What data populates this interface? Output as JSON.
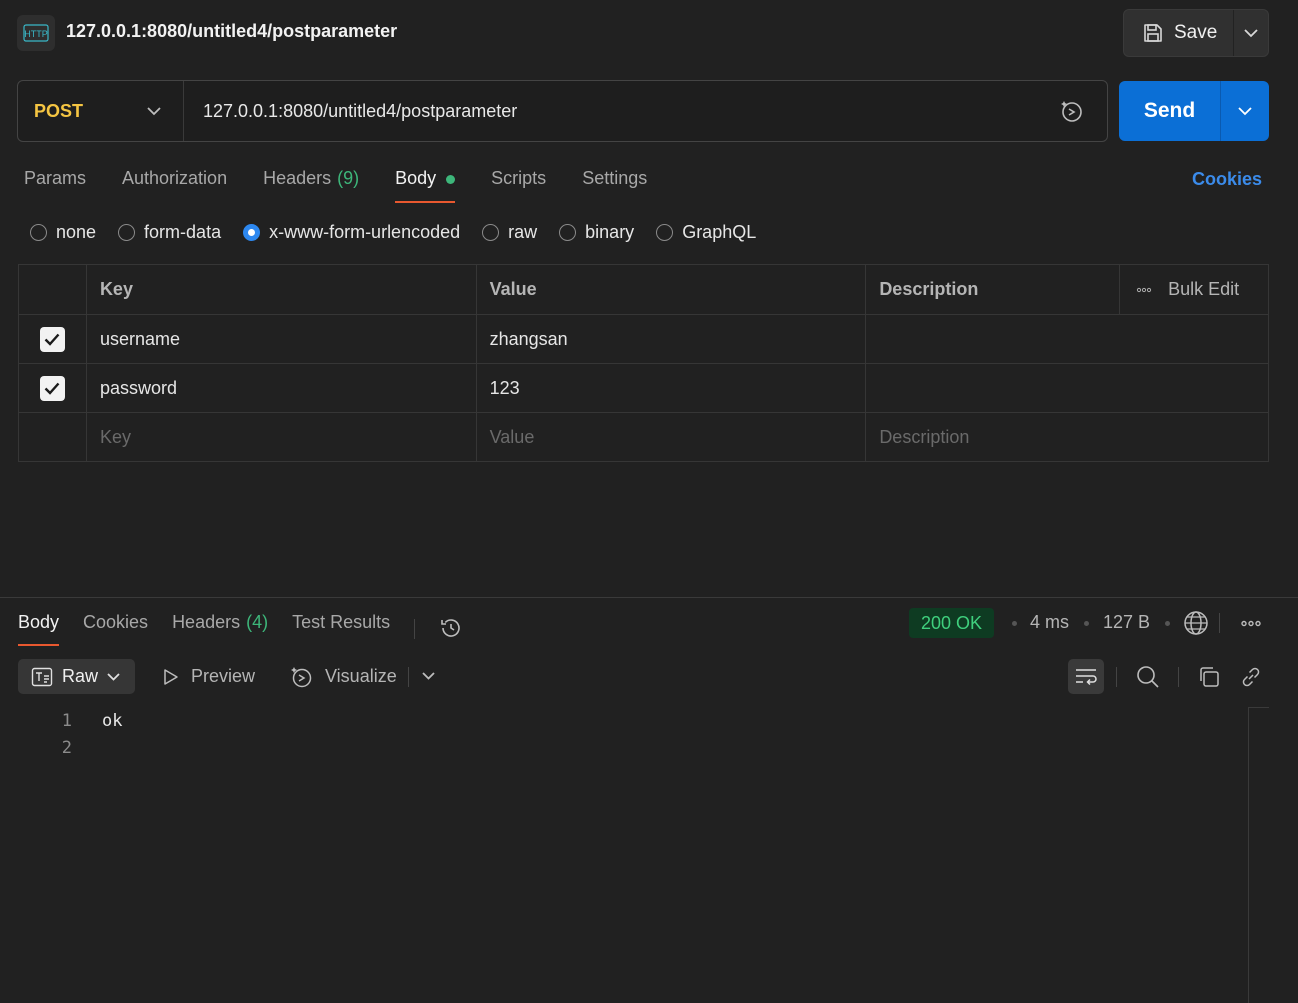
{
  "header": {
    "badge_icon": "http-icon",
    "title": "127.0.0.1:8080/untitled4/postparameter",
    "save_label": "Save"
  },
  "request": {
    "method": "POST",
    "url": "127.0.0.1:8080/untitled4/postparameter",
    "send_label": "Send"
  },
  "tabs": {
    "params": "Params",
    "authorization": "Authorization",
    "headers": "Headers",
    "headers_count": "(9)",
    "body": "Body",
    "scripts": "Scripts",
    "settings": "Settings",
    "cookies": "Cookies"
  },
  "body_types": {
    "none": "none",
    "form_data": "form-data",
    "urlencoded": "x-www-form-urlencoded",
    "raw": "raw",
    "binary": "binary",
    "graphql": "GraphQL",
    "selected": "x-www-form-urlencoded"
  },
  "table": {
    "headers": {
      "key": "Key",
      "value": "Value",
      "description": "Description",
      "bulk_edit": "Bulk Edit"
    },
    "rows": [
      {
        "checked": true,
        "key": "username",
        "value": "zhangsan",
        "description": ""
      },
      {
        "checked": true,
        "key": "password",
        "value": "123",
        "description": ""
      }
    ],
    "placeholder": {
      "key": "Key",
      "value": "Value",
      "description": "Description"
    }
  },
  "response": {
    "tabs": {
      "body": "Body",
      "cookies": "Cookies",
      "headers": "Headers",
      "headers_count": "(4)",
      "test_results": "Test Results"
    },
    "status": "200 OK",
    "time": "4 ms",
    "size": "127 B",
    "toolbar": {
      "format": "Raw",
      "preview": "Preview",
      "visualize": "Visualize"
    },
    "lines": [
      "1",
      "2"
    ],
    "content": "ok"
  },
  "colors": {
    "method": "#f5c542",
    "send": "#0b6fd6",
    "accent_tab": "#e8582f",
    "success": "#3fcf7d",
    "link": "#3b8bea"
  }
}
